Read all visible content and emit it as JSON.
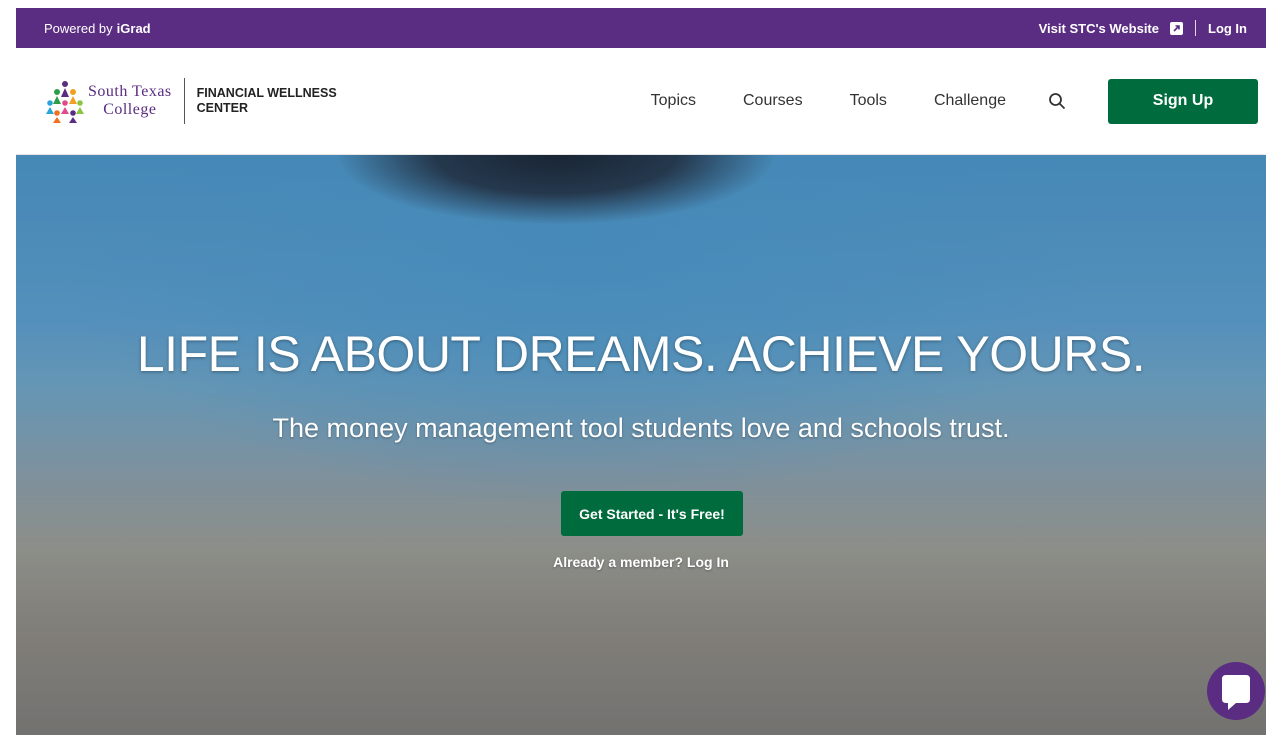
{
  "topbar": {
    "powered_by": "Powered by",
    "igrad": "iGrad",
    "visit_site": "Visit STC's Website",
    "login": "Log In"
  },
  "header": {
    "logo_line1": "South Texas",
    "logo_line2": "College",
    "center_line1": "FINANCIAL WELLNESS",
    "center_line2": "CENTER",
    "nav": [
      "Topics",
      "Courses",
      "Tools",
      "Challenge"
    ],
    "signup": "Sign Up"
  },
  "hero": {
    "title": "LIFE IS ABOUT DREAMS. ACHIEVE YOURS.",
    "subtitle": "The money management tool students love and schools trust.",
    "cta": "Get Started - It's Free!",
    "member_link": "Already a member? Log In"
  },
  "icons": {
    "search": "search-icon",
    "external": "external-link-icon",
    "chat": "chat-icon",
    "logo": "people-logo-icon"
  },
  "colors": {
    "purple": "#5a2d82",
    "green": "#006b3c"
  }
}
